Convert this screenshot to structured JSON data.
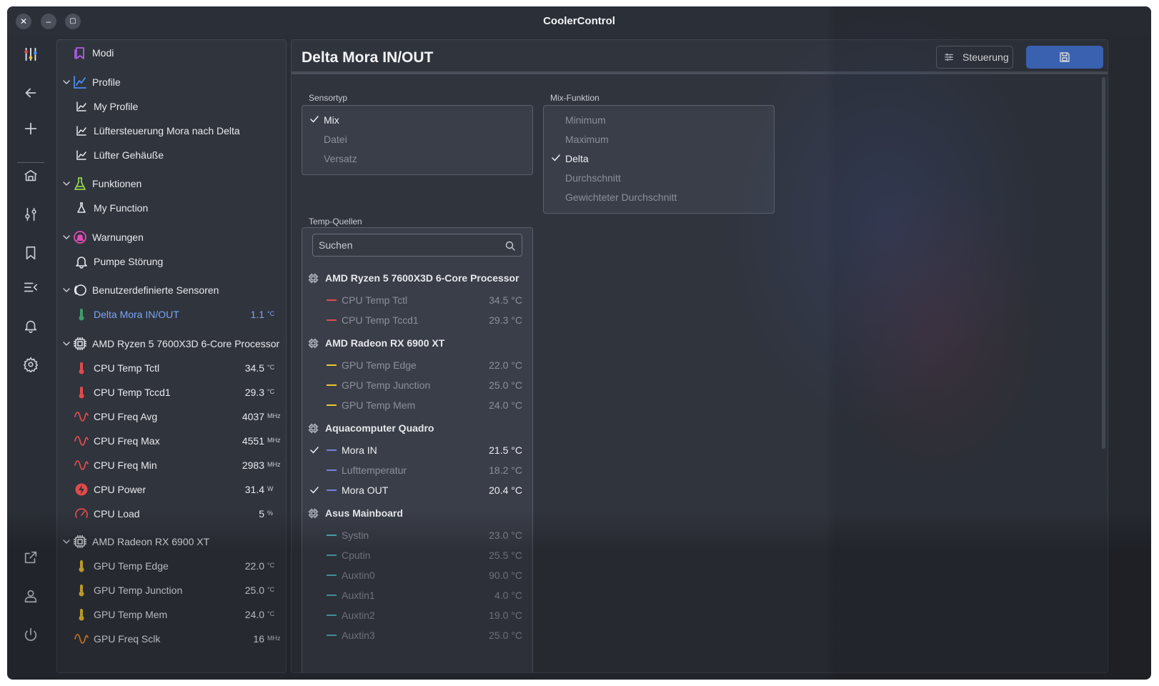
{
  "window": {
    "title": "CoolerControl"
  },
  "titlebar": {
    "close": "✕",
    "minimize": "–",
    "maximize": "▢"
  },
  "colors": {
    "accent": "#3f6cc4",
    "active_text": "#7aa6f5",
    "cpu": "#e04b4b",
    "gpu": "#f0c430",
    "quadro": "#7b7fe0",
    "mainboard": "#4fb3c9"
  },
  "sidebar": {
    "items": [
      {
        "name": "modi",
        "label": "Modi",
        "icon": "bookmark-icon",
        "level": 0,
        "group": false,
        "value": "",
        "unit": ""
      },
      {
        "name": "profile",
        "label": "Profile",
        "icon": "chart-icon",
        "level": 0,
        "group": true,
        "value": "",
        "unit": ""
      },
      {
        "name": "my-profile",
        "label": "My Profile",
        "icon": "small-chart-icon",
        "level": 1,
        "group": false,
        "value": "",
        "unit": ""
      },
      {
        "name": "profile-mora",
        "label": "Lüftersteuerung Mora nach Delta",
        "icon": "small-chart-icon",
        "level": 1,
        "group": false,
        "value": "",
        "unit": ""
      },
      {
        "name": "profile-gehaeuse",
        "label": "Lüfter Gehäuße",
        "icon": "small-chart-icon",
        "level": 1,
        "group": false,
        "value": "",
        "unit": ""
      },
      {
        "name": "funktionen",
        "label": "Funktionen",
        "icon": "flask-icon",
        "level": 0,
        "group": true,
        "value": "",
        "unit": ""
      },
      {
        "name": "my-function",
        "label": "My Function",
        "icon": "small-flask-icon",
        "level": 1,
        "group": false,
        "value": "",
        "unit": ""
      },
      {
        "name": "warnungen",
        "label": "Warnungen",
        "icon": "alert-icon",
        "level": 0,
        "group": true,
        "value": "",
        "unit": ""
      },
      {
        "name": "pumpe-stoerung",
        "label": "Pumpe Störung",
        "icon": "bell-icon",
        "level": 1,
        "group": false,
        "value": "",
        "unit": ""
      },
      {
        "name": "custom-sensors",
        "label": "Benutzerdefinierte Sensoren",
        "icon": "custom-sensor-icon",
        "level": 0,
        "group": true,
        "value": "",
        "unit": ""
      },
      {
        "name": "delta-mora",
        "label": "Delta Mora IN/OUT",
        "icon": "thermometer-icon",
        "level": 1,
        "group": false,
        "value": "1.1",
        "unit": "°C",
        "active": true,
        "color": "#3f9c6a"
      },
      {
        "name": "amd-ryzen",
        "label": "AMD Ryzen 5 7600X3D 6-Core Processor",
        "icon": "chip-icon",
        "level": 0,
        "group": true,
        "value": "",
        "unit": ""
      },
      {
        "name": "cpu-temp-tctl",
        "label": "CPU Temp Tctl",
        "icon": "thermometer-icon",
        "level": 1,
        "group": false,
        "value": "34.5",
        "unit": "°C",
        "color": "#e04b4b"
      },
      {
        "name": "cpu-temp-tccd1",
        "label": "CPU Temp Tccd1",
        "icon": "thermometer-icon",
        "level": 1,
        "group": false,
        "value": "29.3",
        "unit": "°C",
        "color": "#e04b4b"
      },
      {
        "name": "cpu-freq-avg",
        "label": "CPU Freq Avg",
        "icon": "wave-icon",
        "level": 1,
        "group": false,
        "value": "4037",
        "unit": "MHz",
        "color": "#e04b4b"
      },
      {
        "name": "cpu-freq-max",
        "label": "CPU Freq Max",
        "icon": "wave-icon",
        "level": 1,
        "group": false,
        "value": "4551",
        "unit": "MHz",
        "color": "#e04b4b"
      },
      {
        "name": "cpu-freq-min",
        "label": "CPU Freq Min",
        "icon": "wave-icon",
        "level": 1,
        "group": false,
        "value": "2983",
        "unit": "MHz",
        "color": "#e04b4b"
      },
      {
        "name": "cpu-power",
        "label": "CPU Power",
        "icon": "power-bolt-icon",
        "level": 1,
        "group": false,
        "value": "31.4",
        "unit": "W",
        "color": "#e04b4b"
      },
      {
        "name": "cpu-load",
        "label": "CPU Load",
        "icon": "gauge-icon",
        "level": 1,
        "group": false,
        "value": "5",
        "unit": "%",
        "color": "#e04b4b"
      },
      {
        "name": "amd-radeon",
        "label": "AMD Radeon RX 6900 XT",
        "icon": "chip-icon",
        "level": 0,
        "group": true,
        "value": "",
        "unit": ""
      },
      {
        "name": "gpu-temp-edge",
        "label": "GPU Temp Edge",
        "icon": "thermometer-icon",
        "level": 1,
        "group": false,
        "value": "22.0",
        "unit": "°C",
        "color": "#f0c430"
      },
      {
        "name": "gpu-temp-junction",
        "label": "GPU Temp Junction",
        "icon": "thermometer-icon",
        "level": 1,
        "group": false,
        "value": "25.0",
        "unit": "°C",
        "color": "#f0c430"
      },
      {
        "name": "gpu-temp-mem",
        "label": "GPU Temp Mem",
        "icon": "thermometer-icon",
        "level": 1,
        "group": false,
        "value": "24.0",
        "unit": "°C",
        "color": "#f0c430"
      },
      {
        "name": "gpu-freq-sclk",
        "label": "GPU Freq Sclk",
        "icon": "wave-icon",
        "level": 1,
        "group": false,
        "value": "16",
        "unit": "MHz",
        "color": "#f08a30"
      }
    ]
  },
  "main": {
    "title": "Delta Mora IN/OUT",
    "control_label": "Steuerung",
    "sensor_type": {
      "label": "Sensortyp",
      "options": [
        {
          "label": "Mix",
          "selected": true
        },
        {
          "label": "Datei",
          "selected": false
        },
        {
          "label": "Versatz",
          "selected": false
        }
      ]
    },
    "mix_function": {
      "label": "Mix-Funktion",
      "options": [
        {
          "label": "Minimum",
          "selected": false
        },
        {
          "label": "Maximum",
          "selected": false
        },
        {
          "label": "Delta",
          "selected": true
        },
        {
          "label": "Durchschnitt",
          "selected": false
        },
        {
          "label": "Gewichteter Durchschnitt",
          "selected": false
        }
      ]
    },
    "temp_sources": {
      "label": "Temp-Quellen",
      "search_placeholder": "Suchen",
      "groups": [
        {
          "name": "AMD Ryzen 5 7600X3D 6-Core Processor",
          "color": "#e04b4b",
          "sources": [
            {
              "name": "CPU Temp Tctl",
              "value": "34.5 °C",
              "selected": false
            },
            {
              "name": "CPU Temp Tccd1",
              "value": "29.3 °C",
              "selected": false
            }
          ]
        },
        {
          "name": "AMD Radeon RX 6900 XT",
          "color": "#f0c430",
          "sources": [
            {
              "name": "GPU Temp Edge",
              "value": "22.0 °C",
              "selected": false
            },
            {
              "name": "GPU Temp Junction",
              "value": "25.0 °C",
              "selected": false
            },
            {
              "name": "GPU Temp Mem",
              "value": "24.0 °C",
              "selected": false
            }
          ]
        },
        {
          "name": "Aquacomputer Quadro",
          "color": "#7b7fe0",
          "sources": [
            {
              "name": "Mora IN",
              "value": "21.5 °C",
              "selected": true
            },
            {
              "name": "Lufttemperatur",
              "value": "18.2 °C",
              "selected": false
            },
            {
              "name": "Mora OUT",
              "value": "20.4 °C",
              "selected": true
            }
          ]
        },
        {
          "name": "Asus Mainboard",
          "color": "#4fb3c9",
          "sources": [
            {
              "name": "Systin",
              "value": "23.0 °C",
              "selected": false
            },
            {
              "name": "Cputin",
              "value": "25.5 °C",
              "selected": false
            },
            {
              "name": "Auxtin0",
              "value": "90.0 °C",
              "selected": false
            },
            {
              "name": "Auxtin1",
              "value": "4.0 °C",
              "selected": false
            },
            {
              "name": "Auxtin2",
              "value": "19.0 °C",
              "selected": false
            },
            {
              "name": "Auxtin3",
              "value": "25.0 °C",
              "selected": false
            }
          ]
        }
      ]
    }
  }
}
